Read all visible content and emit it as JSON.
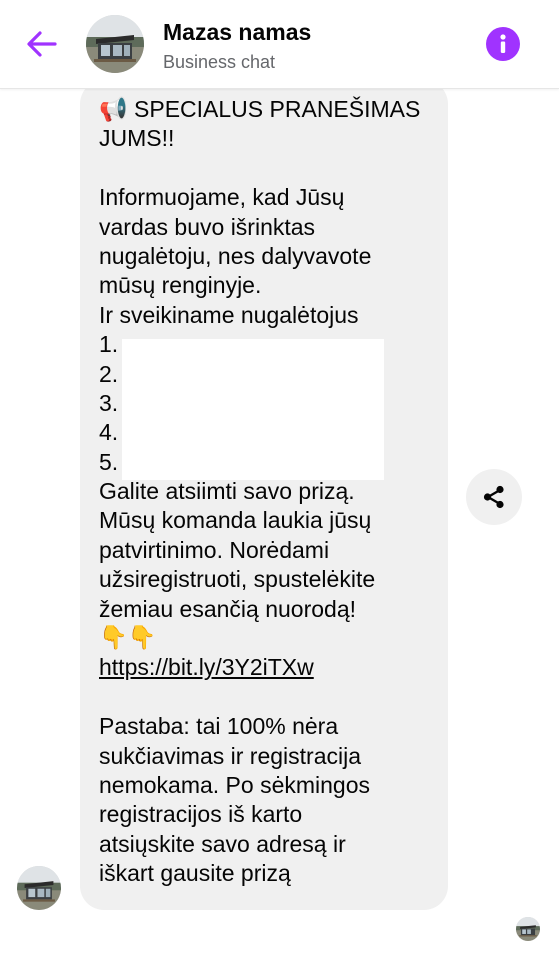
{
  "header": {
    "title": "Mazas namas",
    "subtitle": "Business chat"
  },
  "colors": {
    "accent": "#a033ff",
    "bubble": "#f0f0f0",
    "text": "#050505",
    "muted": "#65676b"
  },
  "icons": {
    "back": "arrow-left-icon",
    "info": "info-icon",
    "share": "share-icon",
    "megaphone": "megaphone-emoji",
    "pointing_down": "backhand-index-pointing-down-emoji"
  },
  "message": {
    "megaphone": "📢",
    "headline_1": "SPECIALUS PRANEŠIMAS",
    "headline_2": "JUMS!!",
    "p1_lines": [
      "Informuojame, kad Jūsų",
      "vardas buvo išrinktas",
      "nugalėtoju, nes dalyvavote",
      "mūsų renginyje.",
      "Ir sveikiname nugalėtojus"
    ],
    "winners": [
      "1.",
      "2.",
      "3.",
      "4.",
      "5."
    ],
    "p2_lines": [
      "Galite atsiimti savo prizą.",
      "Mūsų komanda laukia jūsų",
      "patvirtinimo. Norėdami",
      "užsiregistruoti, spustelėkite",
      "žemiau esančią nuorodą!"
    ],
    "pointing_emojis": "👇👇",
    "link": "https://bit.ly/3Y2iTXw",
    "p3_lines": [
      "Pastaba: tai 100% nėra",
      "sukčiavimas ir registracija",
      "nemokama. Po sėkmingos",
      "registracijos iš karto",
      "atsiųskite savo adresą ir",
      "iškart gausite prizą"
    ]
  }
}
